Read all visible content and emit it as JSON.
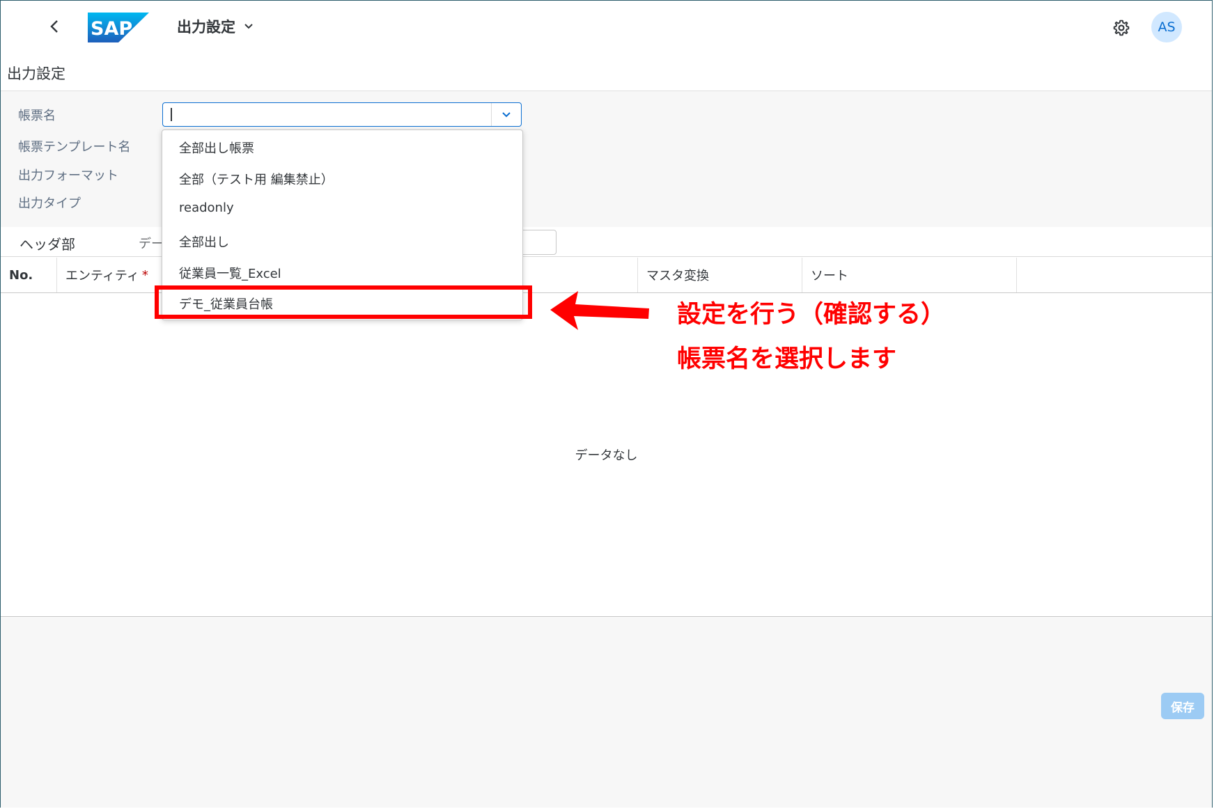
{
  "shell": {
    "app_title": "出力設定",
    "logo_text": "SAP",
    "avatar_initials": "AS"
  },
  "page_title": "出力設定",
  "form": {
    "labels": [
      "帳票名",
      "帳票テンプレート名",
      "出力フォーマット",
      "出力タイプ"
    ],
    "report_name_value": ""
  },
  "tabs": {
    "header_tab": "ヘッダ部",
    "partial_label": "デー"
  },
  "table": {
    "columns": [
      "No.",
      "エンティティ",
      "マスタ変換",
      "ソート"
    ],
    "required_marker": "*",
    "no_data_text": "データなし"
  },
  "dropdown": {
    "items": [
      "全部出し帳票",
      "全部（テスト用 編集禁止）",
      "readonly",
      "全部出し",
      "従業員一覧_Excel",
      "デモ_従業員台帳"
    ],
    "highlighted_index": 5
  },
  "footer": {
    "save_label": "保存"
  },
  "annotation": {
    "line1": "設定を行う（確認する）",
    "line2": "帳票名を選択します",
    "color": "#ff0000"
  }
}
